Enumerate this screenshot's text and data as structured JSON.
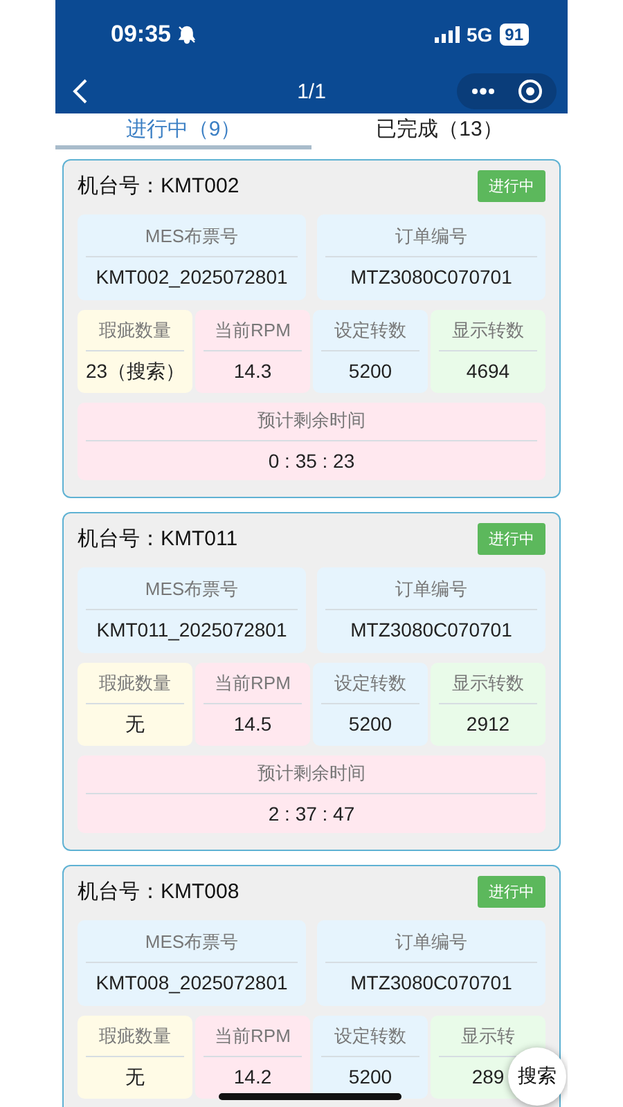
{
  "status_bar": {
    "time": "09:35",
    "network": "5G",
    "battery": "91"
  },
  "nav_bar": {
    "title": "1/1"
  },
  "tabs": [
    {
      "label": "进行中（9）",
      "selected": true
    },
    {
      "label": "已完成（13）",
      "selected": false
    }
  ],
  "cards": [
    {
      "machine": "机台号：KMT002",
      "status": "进行中",
      "mes_ticket": {
        "label": "MES布票号",
        "value": "KMT002_2025072801",
        "color": "#e6f4fd"
      },
      "order_no": {
        "label": "订单编号",
        "value": "MTZ3080C070701",
        "color": "#e6f4fd"
      },
      "metrics": [
        {
          "label": "瑕疵数量",
          "value": "23（搜索）",
          "color": "#fffbe6"
        },
        {
          "label": "当前RPM",
          "value": "14.3",
          "color": "#ffe8ef"
        },
        {
          "label": "设定转数",
          "value": "5200",
          "color": "#e6f4fd"
        },
        {
          "label": "显示转数",
          "value": "4694",
          "color": "#e9fbe9"
        }
      ],
      "remaining_time": {
        "label": "预计剩余时间",
        "value": "0 : 35 : 23",
        "color": "#ffe8ef"
      }
    },
    {
      "machine": "机台号：KMT011",
      "status": "进行中",
      "mes_ticket": {
        "label": "MES布票号",
        "value": "KMT011_2025072801",
        "color": "#e6f4fd"
      },
      "order_no": {
        "label": "订单编号",
        "value": "MTZ3080C070701",
        "color": "#e6f4fd"
      },
      "metrics": [
        {
          "label": "瑕疵数量",
          "value": "无",
          "color": "#fffbe6"
        },
        {
          "label": "当前RPM",
          "value": "14.5",
          "color": "#ffe8ef"
        },
        {
          "label": "设定转数",
          "value": "5200",
          "color": "#e6f4fd"
        },
        {
          "label": "显示转数",
          "value": "2912",
          "color": "#e9fbe9"
        }
      ],
      "remaining_time": {
        "label": "预计剩余时间",
        "value": "2 : 37 : 47",
        "color": "#ffe8ef"
      }
    },
    {
      "machine": "机台号：KMT008",
      "status": "进行中",
      "mes_ticket": {
        "label": "MES布票号",
        "value": "KMT008_2025072801",
        "color": "#e6f4fd"
      },
      "order_no": {
        "label": "订单编号",
        "value": "MTZ3080C070701",
        "color": "#e6f4fd"
      },
      "metrics": [
        {
          "label": "瑕疵数量",
          "value": "无",
          "color": "#fffbe6"
        },
        {
          "label": "当前RPM",
          "value": "14.2",
          "color": "#ffe8ef"
        },
        {
          "label": "设定转数",
          "value": "5200",
          "color": "#e6f4fd"
        },
        {
          "label": "显示转",
          "value": "289",
          "color": "#e9fbe9"
        }
      ]
    }
  ],
  "search_button": {
    "label": "搜索"
  }
}
